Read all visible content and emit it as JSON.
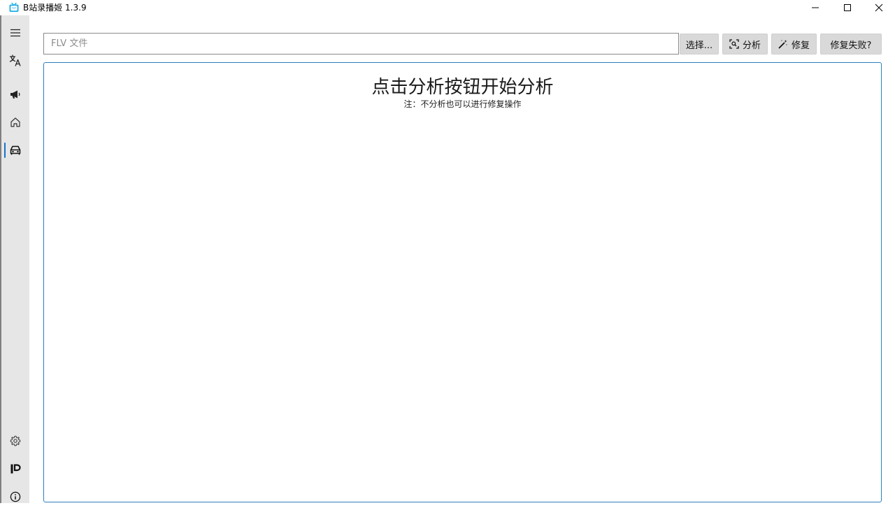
{
  "window": {
    "title": "B站录播姬 1.3.9",
    "icon": "bilibili-tv-icon",
    "controls": [
      "minimize-icon",
      "maximize-icon",
      "close-icon"
    ]
  },
  "sidebar": {
    "items": [
      {
        "icon": "menu-icon",
        "label": ""
      },
      {
        "icon": "translate-icon",
        "label": ""
      },
      {
        "icon": "megaphone-icon",
        "label": ""
      },
      {
        "icon": "home-icon",
        "label": ""
      },
      {
        "icon": "toolbox-icon",
        "label": "",
        "active": true
      },
      {
        "icon": "gear-icon",
        "label": ""
      },
      {
        "icon": "patreon-icon",
        "label": ""
      },
      {
        "icon": "info-icon",
        "label": ""
      }
    ]
  },
  "toolbar": {
    "file_input": {
      "placeholder": "FLV 文件",
      "value": ""
    },
    "select_label": "选择...",
    "analyze_label": "分析",
    "repair_label": "修复",
    "repair_failed_label": "修复失败?"
  },
  "main": {
    "heading": "点击分析按钮开始分析",
    "note": "注：不分析也可以进行修复操作"
  },
  "colors": {
    "accent": "#1a73c9",
    "panel_border": "#2f7fbd",
    "sidebar_bg": "#e6e6e6",
    "button_bg": "#d9d9d9",
    "app_icon": "#23ade5"
  }
}
